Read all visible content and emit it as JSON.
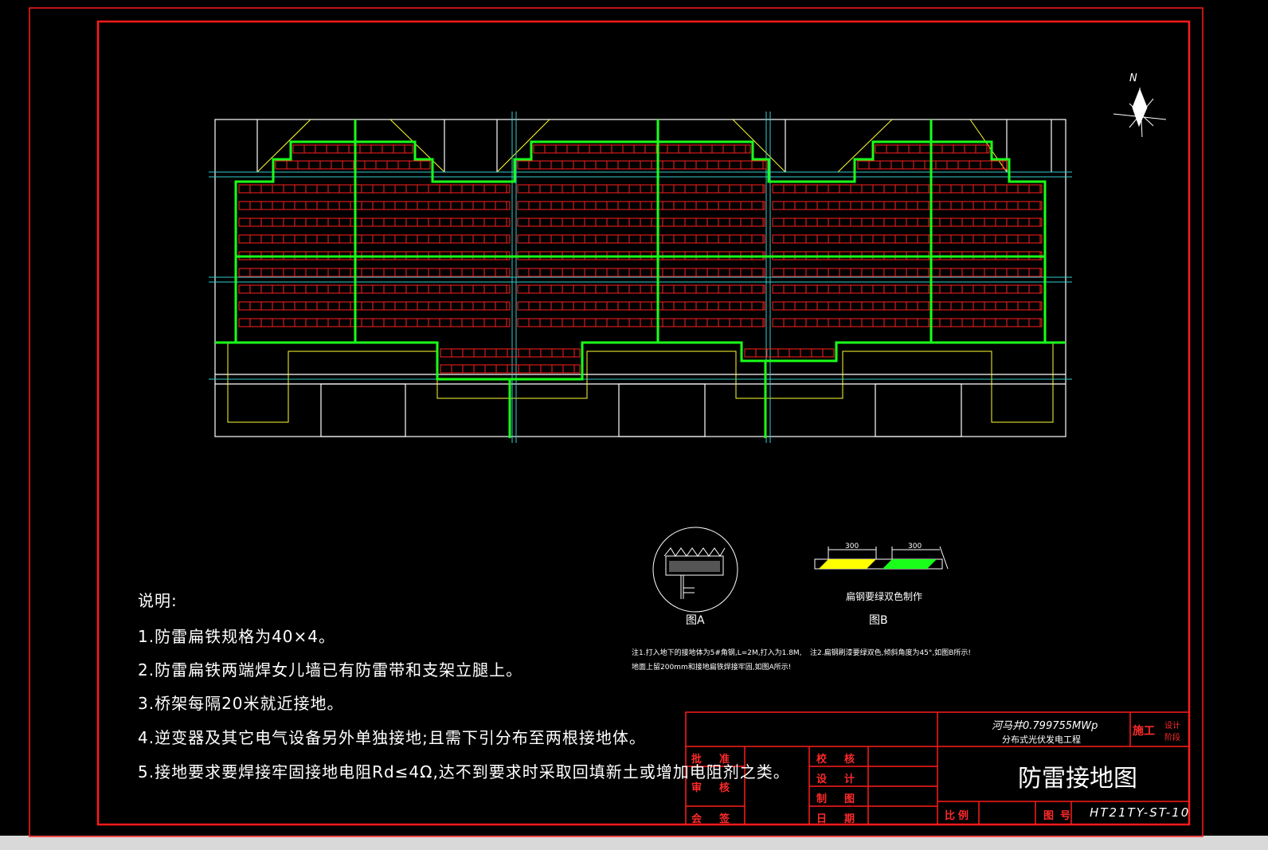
{
  "drawing": {
    "north_label": "N",
    "notes_heading": "说明:",
    "notes": [
      "1.防雷扁铁规格为40×4。",
      "2.防雷扁铁两端焊女儿墙已有防雷带和支架立腿上。",
      "3.桥架每隔20米就近接地。",
      "4.逆变器及其它电气设备另外单独接地;且需下引分布至两根接地体。",
      "5.接地要求要焊接牢固接地电阻Rd≤4Ω,达不到要求时采取回填新土或增加电阻剂之类。"
    ],
    "detail_a": {
      "caption": "图A",
      "note_line1": "注1.打入地下的接地体为5#角钢,L=2M,打入为1.8M,",
      "note_line2": "地面上留200mm和接地扁铁焊接牢固,如图A所示!"
    },
    "detail_b": {
      "dim_left": "300",
      "dim_right": "300",
      "label": "扁钢要绿双色制作",
      "caption": "图B",
      "note": "注2.扁钢刷漆要绿双色,倾斜角度为45°,如图B所示!"
    }
  },
  "title_block": {
    "project_line1": "河马井0.799755MWp",
    "project_line2": "分布式光伏发电工程",
    "stage_main": "施工",
    "stage_sub1": "设计",
    "stage_sub2": "阶段",
    "approve": "批准",
    "check": "校核",
    "review": "审核",
    "design": "设计",
    "draw": "制图",
    "countersign": "会签",
    "date": "日期",
    "drawing_title": "防雷接地图",
    "scale_label": "比例",
    "number_label": "图号",
    "drawing_number": "HT21TY-ST-10"
  },
  "colors": {
    "border": "#ff1a1a",
    "grounding": "#1aff1a",
    "panels": "#ff2020",
    "structure": "#ffffff",
    "outline": "#ffff33",
    "axis": "#33cccc"
  }
}
